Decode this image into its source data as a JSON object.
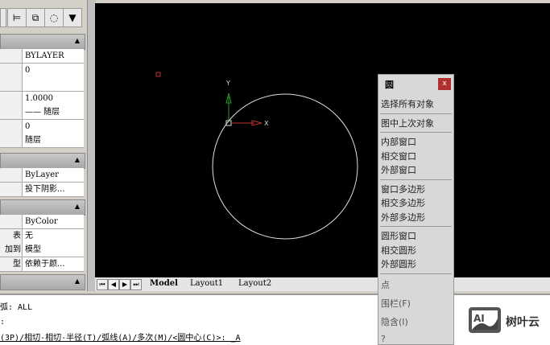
{
  "toolbar": {
    "icons": [
      "quick-select-icon",
      "select-objects-icon",
      "toggle-pickadd-icon",
      "filter-icon"
    ]
  },
  "properties": {
    "general": [
      {
        "key": "",
        "value": "BYLAYER"
      },
      {
        "key": "",
        "value": "0"
      },
      {
        "key": "",
        "value": ""
      },
      {
        "key": "",
        "value": "1.0000"
      },
      {
        "key": "",
        "value": "—— 随层"
      },
      {
        "key": "",
        "value": "0"
      },
      {
        "key": "",
        "value": "随层"
      }
    ],
    "section3": [
      {
        "key": "",
        "value": "ByLayer"
      },
      {
        "key": "",
        "value": "投下阴影..."
      }
    ],
    "section4": [
      {
        "key": "",
        "value": "ByColor"
      },
      {
        "key": "表",
        "value": "无"
      },
      {
        "key": "加到",
        "value": "模型"
      },
      {
        "key": "型",
        "value": "依赖于颜..."
      }
    ]
  },
  "tabs": {
    "model": "Model",
    "layout1": "Layout1",
    "layout2": "Layout2"
  },
  "canvas": {
    "x_label": "X",
    "y_label": "Y"
  },
  "command": {
    "line1": "弧: ALL",
    "line2": ":",
    "line3": "(3P)/相切-相切-半径(T)/弧线(A)/多次(M)/<圆中心(C)>: _A"
  },
  "menu": {
    "title": "圆",
    "close": "x",
    "groups": [
      [
        "选择所有对象"
      ],
      [
        "图中上次对象"
      ],
      [
        "内部窗口",
        "相交窗口",
        "外部窗口"
      ],
      [
        "窗口多边形",
        "相交多边形",
        "外部多边形"
      ],
      [
        "圆形窗口",
        "相交圆形",
        "外部圆形"
      ]
    ],
    "extra": [
      "点",
      "围栏(F)",
      "隐含(I)",
      "?"
    ]
  },
  "watermark": {
    "logo": "AI",
    "text": "树叶云"
  }
}
